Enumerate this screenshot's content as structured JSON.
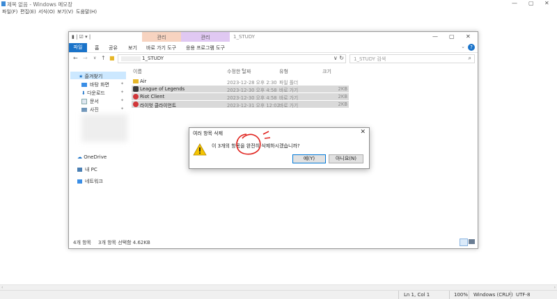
{
  "notepad": {
    "title": "제목 없음 - Windows 메모장",
    "menu": [
      "파일(F)",
      "편집(E)",
      "서식(O)",
      "보기(V)",
      "도움말(H)"
    ],
    "status": {
      "position": "Ln 1, Col 1",
      "zoom": "100%",
      "line_ending": "Windows (CRLF)",
      "encoding": "UTF-8"
    },
    "win_controls": [
      "—",
      "▢",
      "✕"
    ]
  },
  "explorer": {
    "folder_name": "1_STUDY",
    "context_tab1": "관리",
    "context_tab2": "관리",
    "ribbon_tabs": [
      "파일",
      "홈",
      "공유",
      "보기",
      "바로 가기 도구",
      "응용 프로그램 도구"
    ],
    "address_path": "1_STUDY",
    "search_placeholder": "1_STUDY 검색",
    "nav": {
      "quick_access": "즐겨찾기",
      "items": [
        "바탕 화면",
        "다운로드",
        "문서",
        "사진"
      ],
      "onedrive": "OneDrive",
      "this_pc": "내 PC",
      "network": "네트워크"
    },
    "columns": [
      "이름",
      "수정한 날짜",
      "유형",
      "크기"
    ],
    "files": [
      {
        "name": "Air",
        "date": "2023-12-28 오후 2:30",
        "type": "파일 폴더",
        "size": "",
        "selected": false
      },
      {
        "name": "League of Legends",
        "date": "2023-12-30 오후 4:58",
        "type": "바로 가기",
        "size": "2KB",
        "selected": true
      },
      {
        "name": "Riot Client",
        "date": "2023-12-30 오후 4:58",
        "type": "바로 가기",
        "size": "2KB",
        "selected": true
      },
      {
        "name": "라이엇 클라이언트",
        "date": "2023-12-31 오후 12:02",
        "type": "바로 가기",
        "size": "2KB",
        "selected": true
      }
    ],
    "status_count": "4개 항목",
    "status_selected": "3개 항목 선택함 4.62KB"
  },
  "dialog": {
    "title": "여러 항목 삭제",
    "message": "이 3개의 항목을 완전히 삭제하시겠습니까?",
    "yes": "예(Y)",
    "no": "아니요(N)"
  },
  "colors": {
    "accent": "#1a73c9",
    "selection": "#d9d9d9",
    "annotation": "#e0201b"
  }
}
